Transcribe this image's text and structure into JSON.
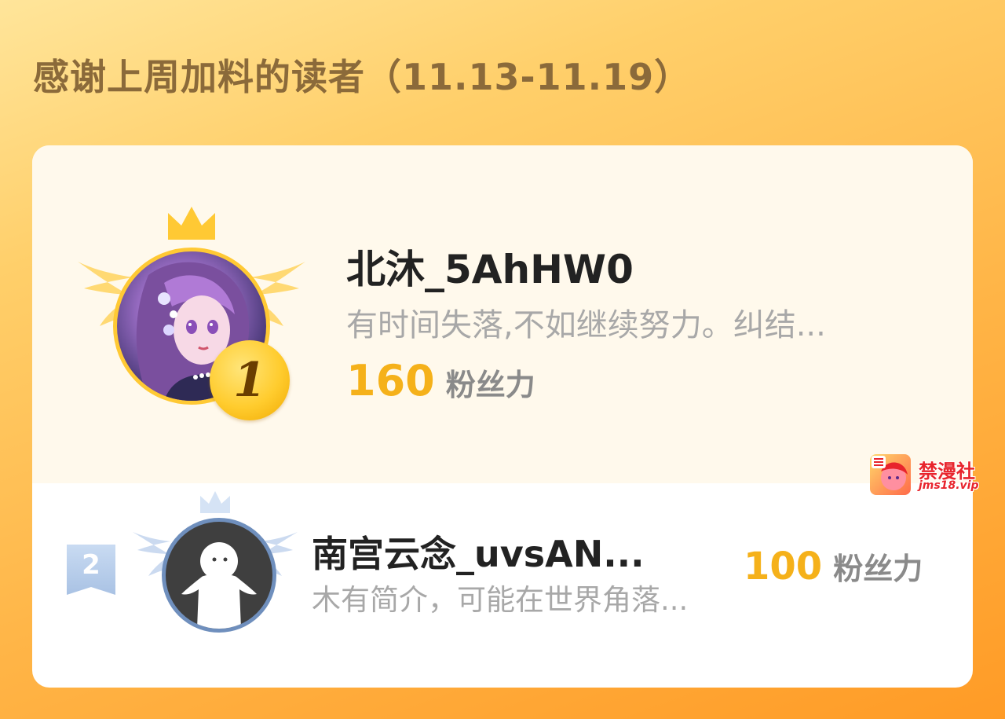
{
  "page": {
    "title": "感谢上周加料的读者（11.13-11.19）"
  },
  "leaderboard": [
    {
      "rank": "1",
      "name": "北沐_5AhHW0",
      "bio": "有时间失落,不如继续努力。纠结...",
      "score": "160",
      "score_unit": "粉丝力",
      "avatar": "anime-girl-avatar",
      "badge_color": "#ffc934"
    },
    {
      "rank": "2",
      "name": "南宫云念_uvsAN...",
      "bio": "木有简介，可能在世界角落...",
      "score": "100",
      "score_unit": "粉丝力",
      "avatar": "default-user-avatar",
      "badge_color": "#6f8fbd"
    }
  ],
  "watermark": {
    "name": "禁漫社",
    "url": "jms18.vip"
  },
  "colors": {
    "accent": "#f5b11a",
    "title": "#8b6a3a",
    "watermark": "#e8242c"
  }
}
